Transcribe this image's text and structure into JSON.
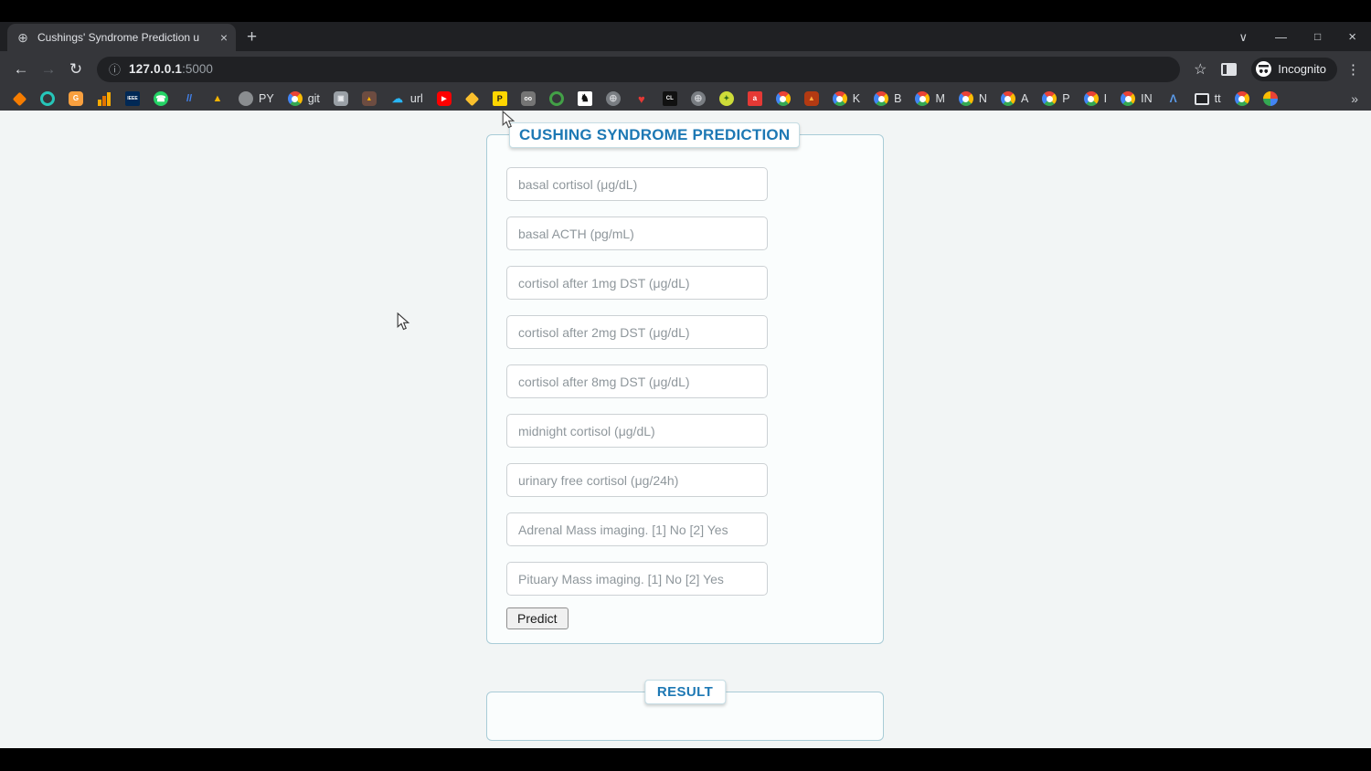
{
  "browser": {
    "tab_title": "Cushings' Syndrome Prediction u",
    "url_host": "127.0.0.1",
    "url_port": ":5000",
    "incognito_label": "Incognito",
    "icons": {
      "favicon": "⊕",
      "close_tab": "×",
      "new_tab": "+",
      "chevron": "∨",
      "minimize": "—",
      "restore": "□",
      "close": "×",
      "back": "←",
      "forward": "→",
      "reload": "↻",
      "info": "ⓘ",
      "star": "☆",
      "menu": "⋮",
      "overflow": "»"
    },
    "bookmarks": [
      {
        "name": "spark-icon",
        "shape": "diamond",
        "bg": "#f57c00",
        "glyph": ""
      },
      {
        "name": "swirl-icon",
        "shape": "ring",
        "fg": "#26c6b9",
        "glyph": ""
      },
      {
        "name": "orange-app-icon",
        "shape": "rounded",
        "bg": "#f9a03f",
        "fg": "#ffffff",
        "glyph": "G",
        "size": 8
      },
      {
        "name": "analytics-bars-icon",
        "shape": "bars",
        "glyph": ""
      },
      {
        "name": "ieee-icon",
        "shape": "square",
        "bg": "#002855",
        "fg": "#ffffff",
        "glyph": "IEEE",
        "size": 5
      },
      {
        "name": "whatsapp-icon",
        "shape": "circle",
        "bg": "#25d366",
        "fg": "#ffffff",
        "glyph": "☎",
        "size": 9
      },
      {
        "name": "google-ads-icon",
        "shape": "plain",
        "fg": "#4285f4",
        "glyph": "//",
        "size": 11
      },
      {
        "name": "triangle-logo-icon",
        "shape": "plain",
        "fg": "#f4b400",
        "glyph": "▲",
        "size": 11
      },
      {
        "name": "py-site-icon",
        "shape": "circle",
        "bg": "#8a8d90",
        "glyph": "",
        "label": "PY"
      },
      {
        "name": "google-icon",
        "shape": "google",
        "glyph": "",
        "label": "git"
      },
      {
        "name": "camera-icon",
        "shape": "rounded",
        "bg": "#9aa0a6",
        "fg": "#e8eaed",
        "glyph": "▣",
        "size": 8
      },
      {
        "name": "bim-logo-icon",
        "shape": "rounded",
        "bg": "#6d4c41",
        "fg": "#ffb300",
        "glyph": "▲",
        "size": 7
      },
      {
        "name": "url-shortener-icon",
        "shape": "plain",
        "fg": "#29b6f6",
        "glyph": "☁",
        "size": 12,
        "label": "url"
      },
      {
        "name": "youtube-icon",
        "shape": "rounded",
        "bg": "#ff0000",
        "fg": "#ffffff",
        "glyph": "▶",
        "size": 7
      },
      {
        "name": "sticker-icon",
        "shape": "diamond",
        "bg": "#fbc02d",
        "glyph": ""
      },
      {
        "name": "p-square-icon",
        "shape": "square",
        "bg": "#ffd600",
        "fg": "#1a1a1a",
        "glyph": "P",
        "size": 9
      },
      {
        "name": "goggles-icon",
        "shape": "rounded",
        "bg": "#757575",
        "fg": "#ffffff",
        "glyph": "oo",
        "size": 7
      },
      {
        "name": "green-ring-icon",
        "shape": "ring",
        "fg": "#43a047",
        "glyph": ""
      },
      {
        "name": "bird-logo-icon",
        "shape": "square",
        "bg": "#ffffff",
        "fg": "#111111",
        "glyph": "♞",
        "size": 11
      },
      {
        "name": "globe-site-icon",
        "shape": "circle",
        "bg": "#797d82",
        "fg": "#caccd0",
        "glyph": "⊕",
        "size": 11
      },
      {
        "name": "heart-icon",
        "shape": "plain",
        "fg": "#e53935",
        "glyph": "♥",
        "size": 13
      },
      {
        "name": "cl-icon",
        "shape": "square",
        "bg": "#111111",
        "fg": "#ffffff",
        "glyph": "CL",
        "size": 6
      },
      {
        "name": "globe-site-icon",
        "shape": "circle",
        "bg": "#797d82",
        "fg": "#caccd0",
        "glyph": "⊕",
        "size": 11
      },
      {
        "name": "coin-icon",
        "shape": "circle",
        "bg": "#cddc39",
        "fg": "#33691e",
        "glyph": "✦",
        "size": 8
      },
      {
        "name": "red-app-icon",
        "shape": "square",
        "bg": "#e53935",
        "fg": "#ffffff",
        "glyph": "a",
        "size": 8
      },
      {
        "name": "google-icon",
        "shape": "google",
        "glyph": ""
      },
      {
        "name": "matlab-icon",
        "shape": "rounded",
        "bg": "#b33a12",
        "fg": "#ffab40",
        "glyph": "▲",
        "size": 8
      },
      {
        "name": "google-icon",
        "shape": "google",
        "glyph": "",
        "label": "K"
      },
      {
        "name": "google-icon",
        "shape": "google",
        "glyph": "",
        "label": "B"
      },
      {
        "name": "google-icon",
        "shape": "google",
        "glyph": "",
        "label": "M"
      },
      {
        "name": "google-icon",
        "shape": "google",
        "glyph": "",
        "label": "N"
      },
      {
        "name": "google-icon",
        "shape": "google",
        "glyph": "",
        "label": "A"
      },
      {
        "name": "google-icon",
        "shape": "google",
        "glyph": "",
        "label": "P"
      },
      {
        "name": "google-icon",
        "shape": "google",
        "glyph": "",
        "label": "I"
      },
      {
        "name": "google-icon",
        "shape": "google",
        "glyph": "",
        "label": "IN"
      },
      {
        "name": "lambda-icon",
        "shape": "plain",
        "fg": "#5c9ded",
        "glyph": "Λ",
        "size": 12
      },
      {
        "name": "monitor-icon",
        "shape": "monitor",
        "glyph": "",
        "label": "tt"
      },
      {
        "name": "google-icon",
        "shape": "google",
        "glyph": ""
      },
      {
        "name": "google-photos-icon",
        "shape": "photos",
        "glyph": ""
      }
    ]
  },
  "page": {
    "form": {
      "title": "CUSHING SYNDROME PREDICTION",
      "fields": [
        "basal cortisol (μg/dL)",
        "basal ACTH (pg/mL)",
        "cortisol after 1mg DST (μg/dL)",
        "cortisol after 2mg DST (μg/dL)",
        "cortisol after 8mg DST (μg/dL)",
        "midnight cortisol (μg/dL)",
        "urinary free cortisol (μg/24h)",
        "Adrenal Mass imaging. [1] No [2] Yes",
        "Pituary Mass imaging. [1] No [2] Yes"
      ],
      "predict_label": "Predict"
    },
    "result": {
      "title": "RESULT",
      "content": ""
    }
  },
  "colors": {
    "accent_blue": "#1d78b4",
    "panel_border": "#a9ccd7",
    "chrome_dark": "#202124",
    "chrome_toolbar": "#35363a"
  }
}
